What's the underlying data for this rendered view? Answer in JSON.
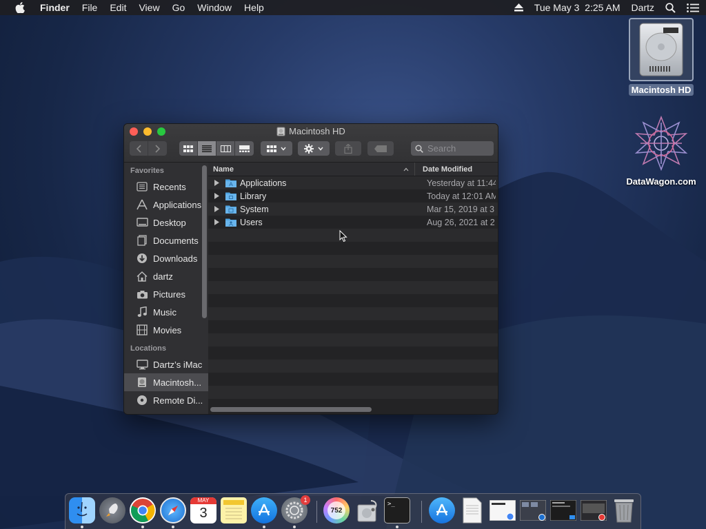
{
  "menubar": {
    "app": "Finder",
    "items": [
      "File",
      "Edit",
      "View",
      "Go",
      "Window",
      "Help"
    ],
    "clock": "Tue May 3  2:25 AM",
    "user": "Dartz"
  },
  "desktop": {
    "hd_label": "Macintosh HD",
    "web_label": "DataWagon.com"
  },
  "window": {
    "title": "Macintosh HD",
    "search_placeholder": "Search",
    "sidebar": {
      "favorites_header": "Favorites",
      "favorites": [
        "Recents",
        "Applications",
        "Desktop",
        "Documents",
        "Downloads",
        "dartz",
        "Pictures",
        "Music",
        "Movies"
      ],
      "locations_header": "Locations",
      "locations": [
        "Dartz’s iMac",
        "Macintosh...",
        "Remote Di..."
      ]
    },
    "columns": {
      "name": "Name",
      "date": "Date Modified"
    },
    "files": [
      {
        "name": "Applications",
        "date": "Yesterday at 11:44"
      },
      {
        "name": "Library",
        "date": "Today at 12:01 AM"
      },
      {
        "name": "System",
        "date": "Mar 15, 2019 at 3"
      },
      {
        "name": "Users",
        "date": "Aug 26, 2021 at 2"
      }
    ]
  },
  "dock": {
    "calendar_month": "MAY",
    "calendar_day": "3",
    "prefs_badge": "1",
    "disk_label": "752",
    "terminal_prompt": ">_"
  },
  "colors": {
    "folder_blue": "#4fa3e0",
    "close": "#ff5f57",
    "minimize": "#febc2e",
    "maximize": "#28c840"
  }
}
